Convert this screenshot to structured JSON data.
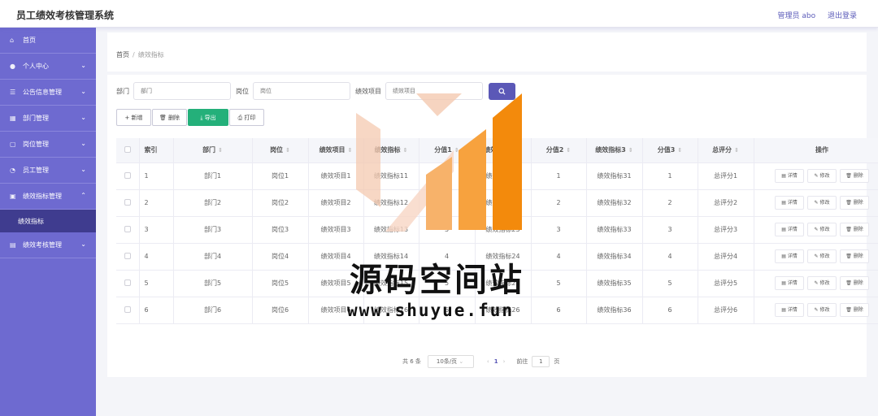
{
  "header": {
    "title": "员工绩效考核管理系统",
    "user": "管理员 abo",
    "logout": "退出登录"
  },
  "sidebar": {
    "items": [
      {
        "label": "首页",
        "icon": "home-icon",
        "glyph": "⌂",
        "expandable": false
      },
      {
        "label": "个人中心",
        "icon": "user-icon",
        "glyph": "●",
        "expandable": true
      },
      {
        "label": "公告信息管理",
        "icon": "sliders-icon",
        "glyph": "☰",
        "expandable": true
      },
      {
        "label": "部门管理",
        "icon": "grid-icon",
        "glyph": "▦",
        "expandable": true
      },
      {
        "label": "岗位管理",
        "icon": "frame-icon",
        "glyph": "▢",
        "expandable": true
      },
      {
        "label": "员工管理",
        "icon": "clock-icon",
        "glyph": "◔",
        "expandable": true
      },
      {
        "label": "绩效指标管理",
        "icon": "window-icon",
        "glyph": "▣",
        "expandable": true,
        "expanded": true,
        "sub": "绩效指标"
      },
      {
        "label": "绩效考核管理",
        "icon": "briefcase-icon",
        "glyph": "▤",
        "expandable": true
      }
    ]
  },
  "breadcrumb": {
    "home": "首页",
    "sep": "/",
    "current": "绩效指标"
  },
  "search": {
    "dept_label": "部门",
    "dept_placeholder": "部门",
    "post_label": "岗位",
    "post_placeholder": "岗位",
    "item_label": "绩效项目",
    "item_placeholder": "绩效项目",
    "button_icon": "search-icon"
  },
  "actions": {
    "add": "+ 新增",
    "delete": "🗑 删除",
    "export": "⤓ 导出",
    "print": "⎙ 打印"
  },
  "table": {
    "columns": [
      "索引",
      "部门",
      "岗位",
      "绩效项目",
      "绩效指标",
      "分值1",
      "绩效指标2",
      "分值2",
      "绩效指标3",
      "分值3",
      "总评分",
      "操作"
    ],
    "row_actions": {
      "detail": "详情",
      "edit": "修改",
      "delete": "删除"
    },
    "rows": [
      [
        "1",
        "部门1",
        "岗位1",
        "绩效项目1",
        "绩效指标11",
        "1",
        "绩效指标21",
        "1",
        "绩效指标31",
        "1",
        "总评分1"
      ],
      [
        "2",
        "部门2",
        "岗位2",
        "绩效项目2",
        "绩效指标12",
        "2",
        "绩效指标22",
        "2",
        "绩效指标32",
        "2",
        "总评分2"
      ],
      [
        "3",
        "部门3",
        "岗位3",
        "绩效项目3",
        "绩效指标13",
        "3",
        "绩效指标23",
        "3",
        "绩效指标33",
        "3",
        "总评分3"
      ],
      [
        "4",
        "部门4",
        "岗位4",
        "绩效项目4",
        "绩效指标14",
        "4",
        "绩效指标24",
        "4",
        "绩效指标34",
        "4",
        "总评分4"
      ],
      [
        "5",
        "部门5",
        "岗位5",
        "绩效项目5",
        "绩效指标15",
        "5",
        "绩效指标25",
        "5",
        "绩效指标35",
        "5",
        "总评分5"
      ],
      [
        "6",
        "部门6",
        "岗位6",
        "绩效项目6",
        "绩效指标16",
        "6",
        "绩效指标26",
        "6",
        "绩效指标36",
        "6",
        "总评分6"
      ]
    ]
  },
  "pager": {
    "total": "共 6 条",
    "page_size": "10条/页",
    "prev": "‹",
    "page": "1",
    "next": "›",
    "goto_label": "前往",
    "goto_value": "1",
    "page_suffix": "页"
  },
  "watermark": {
    "text": "源码空间站",
    "url": "www.shuyue.fun"
  },
  "colors": {
    "sidebar": "#6e6ad0",
    "sidebar_active": "#3f3c8f",
    "primary": "#5b58b7",
    "export": "#24b07a",
    "watermark_orange": "#f39416"
  }
}
